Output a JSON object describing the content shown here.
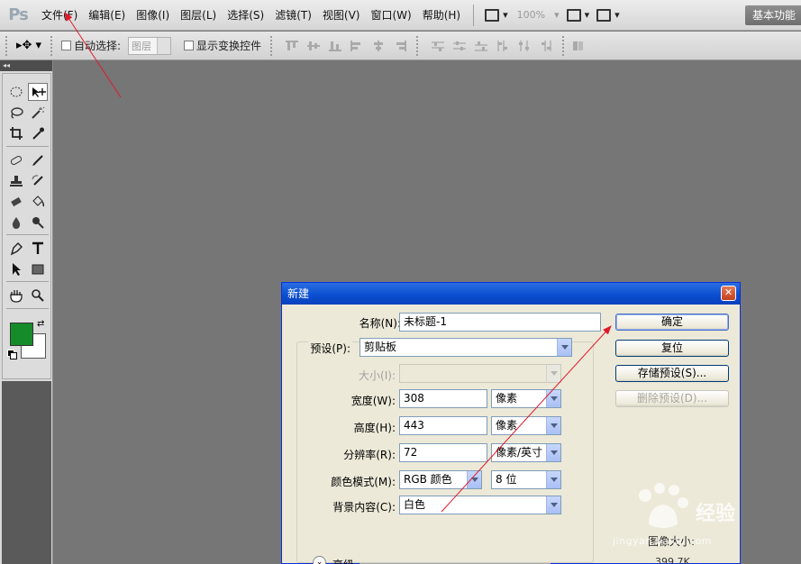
{
  "app": {
    "logo": "Ps",
    "menu": [
      "文件(F)",
      "编辑(E)",
      "图像(I)",
      "图层(L)",
      "选择(S)",
      "滤镜(T)",
      "视图(V)",
      "窗口(W)",
      "帮助(H)"
    ],
    "zoom": "100%",
    "workspace": "基本功能"
  },
  "options_bar": {
    "auto_select_label": "自动选择:",
    "auto_select_target": "图层",
    "show_transform_label": "显示变换控件"
  },
  "toolbox": {
    "collapse_glyph": "◂◂",
    "foreground_color": "#168b2a",
    "background_color": "#ffffff"
  },
  "dialog": {
    "title": "新建",
    "close_glyph": "✕",
    "name_label": "名称(N):",
    "name_value": "未标题-1",
    "preset_label": "预设(P):",
    "preset_value": "剪贴板",
    "size_label": "大小(I):",
    "size_value": "",
    "width_label": "宽度(W):",
    "width_value": "308",
    "width_unit": "像素",
    "height_label": "高度(H):",
    "height_value": "443",
    "height_unit": "像素",
    "resolution_label": "分辨率(R):",
    "resolution_value": "72",
    "resolution_unit": "像素/英寸",
    "color_mode_label": "颜色模式(M):",
    "color_mode_value": "RGB 颜色",
    "bit_depth_value": "8 位",
    "background_label": "背景内容(C):",
    "background_value": "白色",
    "advanced_label": "高级",
    "image_size_label": "图像大小:",
    "image_size_value": "399.7K",
    "buttons": {
      "ok": "确定",
      "reset": "复位",
      "save_preset": "存储预设(S)...",
      "delete_preset": "删除预设(D)..."
    }
  },
  "watermark": {
    "brand": "经验",
    "url": "jingyan.baidu.com"
  },
  "colors": {
    "arrow": "#e0182a",
    "titlebar": "#0a4fcf"
  }
}
